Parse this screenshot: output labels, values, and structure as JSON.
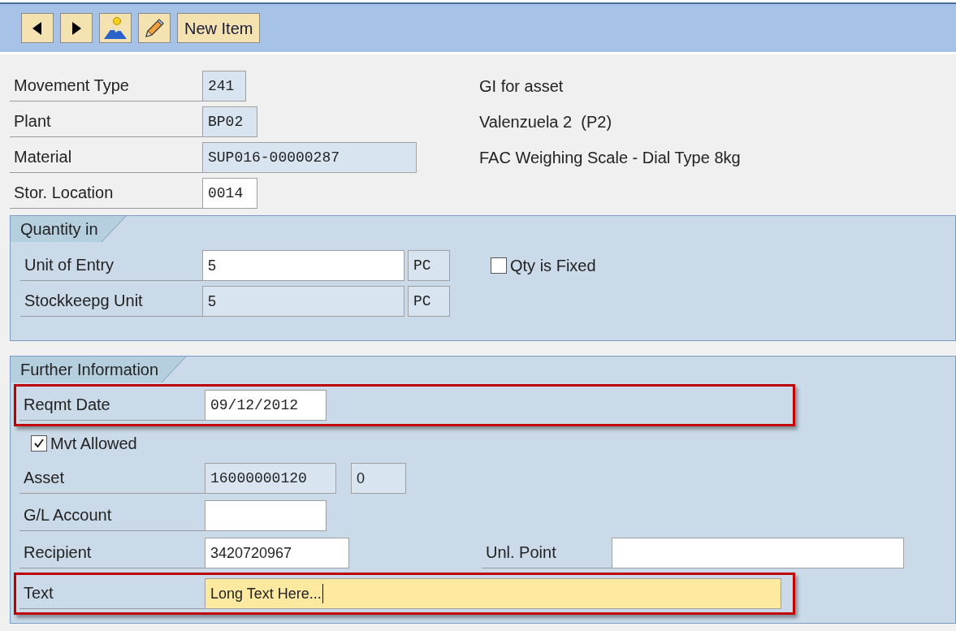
{
  "toolbar": {
    "buttons": [
      {
        "kind": "prev"
      },
      {
        "kind": "next"
      },
      {
        "kind": "picture"
      },
      {
        "kind": "edit"
      },
      {
        "kind": "text",
        "label": "New Item"
      }
    ]
  },
  "header": {
    "rows": [
      {
        "label": "Movement Type",
        "value": "241",
        "editable": false,
        "description": "GI for asset"
      },
      {
        "label": "Plant",
        "value": "BP02",
        "editable": false,
        "description": "Valenzuela 2  (P2)"
      },
      {
        "label": "Material",
        "value": "SUP016-00000287",
        "editable": false,
        "description": "FAC Weighing Scale - Dial Type 8kg"
      },
      {
        "label": "Stor. Location",
        "value": "0014",
        "editable": true
      }
    ]
  },
  "quantity": {
    "title": "Quantity in",
    "rows": [
      {
        "label": "Unit of Entry",
        "value": "5",
        "editable": true,
        "unit": "PC"
      },
      {
        "label": "Stockkeepg Unit",
        "value": "5",
        "editable": false,
        "unit": "PC"
      }
    ],
    "checkbox": {
      "label": "Qty is Fixed",
      "checked": false
    }
  },
  "further": {
    "title": "Further Information",
    "rows": [
      {
        "kind": "field",
        "label": "Reqmt Date",
        "value": "09/12/2012",
        "editable": true,
        "highlighted": true
      },
      {
        "kind": "checkbox",
        "label": "Mvt Allowed",
        "checked": true
      },
      {
        "kind": "field",
        "label": "Asset",
        "value": "16000000120",
        "editable": false,
        "extra": {
          "value": "0",
          "editable": false
        }
      },
      {
        "kind": "field",
        "label": "G/L Account",
        "editable": true
      },
      {
        "kind": "field",
        "label": "Recipient",
        "value": "3420720967",
        "editable": true,
        "side": {
          "label": "Unl. Point",
          "editable": true
        }
      },
      {
        "kind": "field",
        "label": "Text",
        "value": "Long Text Here...",
        "editable": true,
        "focused": true,
        "highlighted": true
      }
    ]
  }
}
